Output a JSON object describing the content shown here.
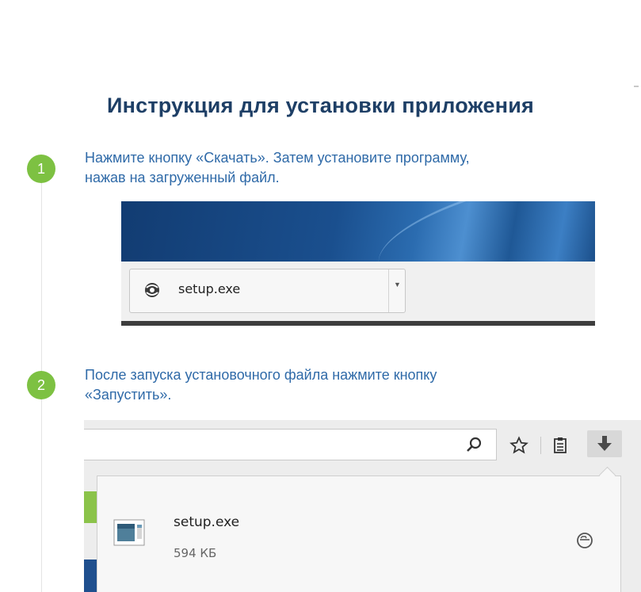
{
  "title": "Инструкция для установки приложения",
  "steps": [
    {
      "number": "1",
      "text_line1": "Нажмите кнопку «Скачать». Затем установите программу,",
      "text_line2": "нажав на загруженный файл.",
      "download_bar": {
        "file_name": "setup.exe"
      }
    },
    {
      "number": "2",
      "text_line1": "После запуска установочного файла нажмите кнопку",
      "text_line2": "«Запустить».",
      "download_panel": {
        "file_name": "setup.exe",
        "file_size": "594 КБ"
      }
    }
  ],
  "colors": {
    "title": "#1e3f66",
    "step_text": "#2f6aa8",
    "step_badge": "#7dc142"
  },
  "icons": {
    "download_file": "download-file-icon",
    "search": "search-icon",
    "bookmark_star": "star-icon",
    "reading_list": "clipboard-icon",
    "downloads": "download-arrow-icon",
    "open_file": "open-folder-icon"
  }
}
